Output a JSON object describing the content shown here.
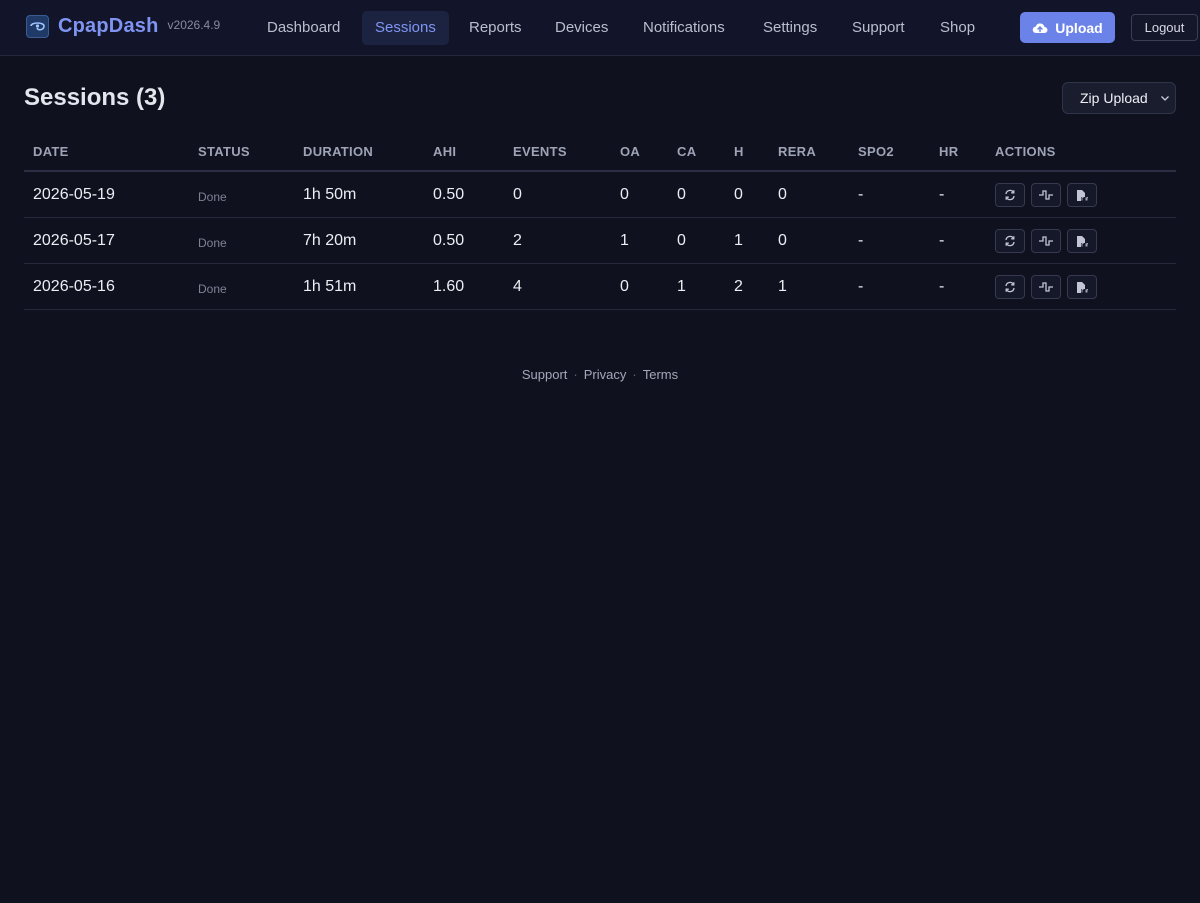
{
  "brand": {
    "name": "CpapDash",
    "version": "v2026.4.9"
  },
  "nav": {
    "items": [
      {
        "label": "Dashboard",
        "active": false
      },
      {
        "label": "Sessions",
        "active": true
      },
      {
        "label": "Reports",
        "active": false
      },
      {
        "label": "Devices",
        "active": false
      },
      {
        "label": "Notifications",
        "active": false
      },
      {
        "label": "Settings",
        "active": false
      },
      {
        "label": "Support",
        "active": false
      },
      {
        "label": "Shop",
        "active": false
      }
    ],
    "upload_label": "Upload",
    "logout_label": "Logout"
  },
  "page": {
    "title": "Sessions (3)",
    "zip_select_value": "Zip Upload"
  },
  "table": {
    "headers": {
      "date": "DATE",
      "status": "STATUS",
      "duration": "DURATION",
      "ahi": "AHI",
      "events": "EVENTS",
      "oa": "OA",
      "ca": "CA",
      "h": "H",
      "rera": "RERA",
      "spo2": "SPO2",
      "hr": "HR",
      "actions": "ACTIONS"
    },
    "rows": [
      {
        "date": "2026-05-19",
        "status": "Done",
        "duration": "1h 50m",
        "ahi": "0.50",
        "events": "0",
        "oa": "0",
        "ca": "0",
        "h": "0",
        "rera": "0",
        "spo2": "-",
        "hr": "-"
      },
      {
        "date": "2026-05-17",
        "status": "Done",
        "duration": "7h 20m",
        "ahi": "0.50",
        "events": "2",
        "oa": "1",
        "ca": "0",
        "h": "1",
        "rera": "0",
        "spo2": "-",
        "hr": "-"
      },
      {
        "date": "2026-05-16",
        "status": "Done",
        "duration": "1h 51m",
        "ahi": "1.60",
        "events": "4",
        "oa": "0",
        "ca": "1",
        "h": "2",
        "rera": "1",
        "spo2": "-",
        "hr": "-"
      }
    ],
    "row_actions": [
      "refresh-icon",
      "waveform-icon",
      "pdf-icon"
    ]
  },
  "footer": {
    "links": [
      "Support",
      "Privacy",
      "Terms"
    ],
    "separator": "·"
  },
  "colors": {
    "background": "#0f111e",
    "accent": "#6b82e8",
    "brand_text": "#7f93f0"
  }
}
